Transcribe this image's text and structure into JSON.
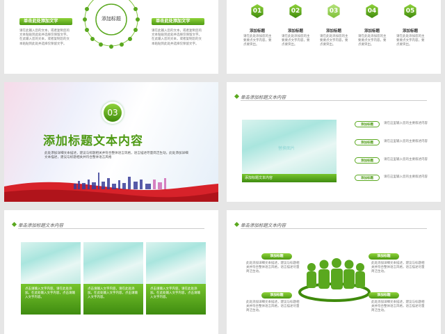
{
  "s1": {
    "center_label": "添加标题",
    "left_title": "单击此处添加文字",
    "right_title": "单击此处添加文字",
    "left_text": "请在此输入您的文本，或者复制您的文本粘贴到此处并选择仅保留文字。在此输入您的文本，或者复制您的文本粘贴到此处并选择仅保留文字。",
    "right_text": "请在此输入您的文本，或者复制您的文本粘贴到此处并选择仅保留文字。在此输入您的文本，或者复制您的文本粘贴到此处并选择仅保留文字。"
  },
  "s2": {
    "items": [
      {
        "num": "01",
        "title": "添加标题",
        "text": "请在此处添加您的主要要点文字内容，要点要突出。"
      },
      {
        "num": "02",
        "title": "添加标题",
        "text": "请在此处添加您的主要要点文字内容，要点要突出。"
      },
      {
        "num": "03",
        "title": "添加标题",
        "text": "请在此处添加您的主要要点文字内容，要点要突出。"
      },
      {
        "num": "04",
        "title": "添加标题",
        "text": "请在此处添加您的主要要点文字内容，要点要突出。"
      },
      {
        "num": "05",
        "title": "添加标题",
        "text": "请在此处添加您的主要要点文字内容，要点要突出。"
      }
    ]
  },
  "s3": {
    "number": "03",
    "title": "添加标题文本内容",
    "text": "此处添加详细文本描述，建议与标题相关并符合整体语言风格，语言描述尽量简洁生动。此处添加详细文本描述，建议与标题相关并符合整体语言风格"
  },
  "s4": {
    "header": "单击添加标题文本内容",
    "image_placeholder": "替换图片",
    "caption": "添加标题文本内容",
    "tags": [
      {
        "label": "添加标题",
        "text": "请在这里输入您的主要叙述内容"
      },
      {
        "label": "添加标题",
        "text": "请在这里输入您的主要叙述内容"
      },
      {
        "label": "添加标题",
        "text": "请在这里输入您的主要叙述内容"
      },
      {
        "label": "添加标题",
        "text": "请在这里输入您的主要叙述内容"
      }
    ]
  },
  "s5": {
    "header": "单击添加标题文本内容",
    "cards": [
      {
        "text": "点击请输入文字内容，请在此处添加。在此处输入文字内容，点击请输入文字内容。"
      },
      {
        "text": "点击请输入文字内容，请在此处添加。在此处输入文字内容，点击请输入文字内容。"
      },
      {
        "text": "点击请输入文字内容，请在此处添加。在此处输入文字内容，点击请输入文字内容。"
      }
    ]
  },
  "s6": {
    "header": "单击添加标题文本内容",
    "pills": [
      {
        "label": "添加标题",
        "text": "此处添加详细文本描述，建议与标题相关并符合整体语言风格，语言描述尽量简洁生动。"
      },
      {
        "label": "添加标题",
        "text": "此处添加详细文本描述，建议与标题相关并符合整体语言风格，语言描述尽量简洁生动。"
      },
      {
        "label": "添加标题",
        "text": "此处添加详细文本描述，建议与标题相关并符合整体语言风格，语言描述尽量简洁生动。"
      },
      {
        "label": "添加标题",
        "text": "此处添加详细文本描述，建议与标题相关并符合整体语言风格，语言描述尽量简洁生动。"
      }
    ]
  },
  "colors": {
    "accent": "#5aa81f",
    "accent_dark": "#3f8a0c",
    "background": "#e6e6e6"
  }
}
